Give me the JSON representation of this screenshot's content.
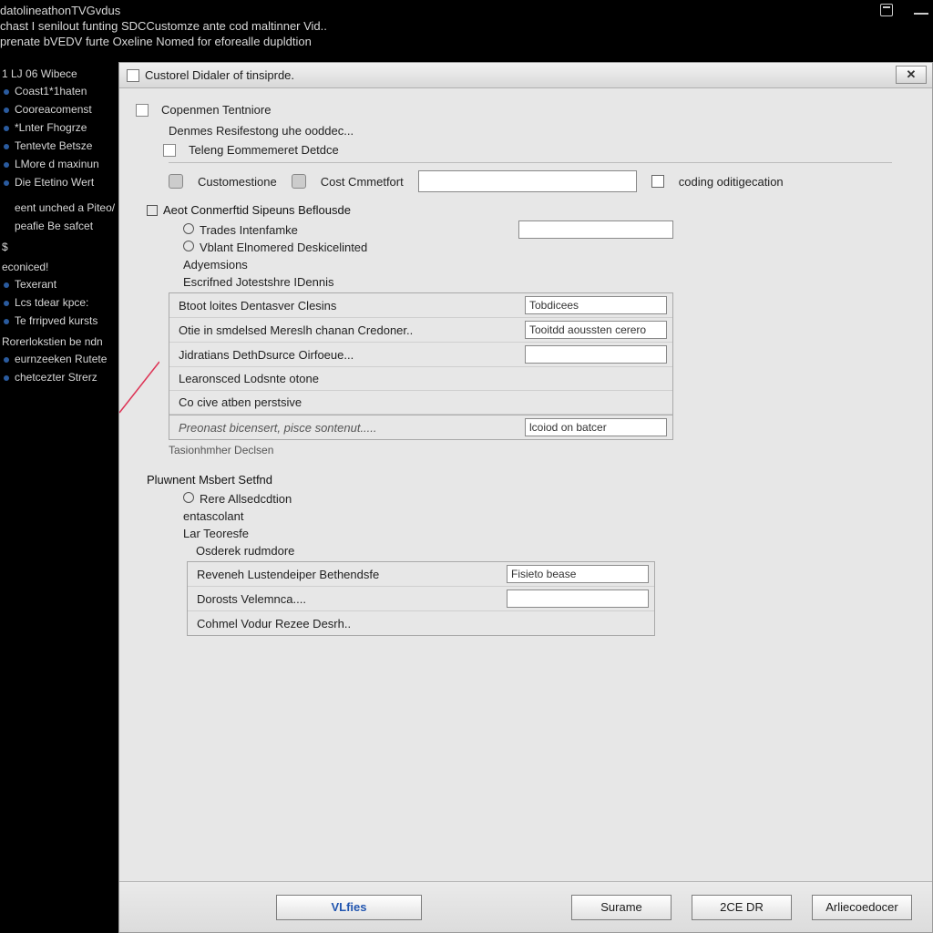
{
  "header": {
    "line1": "datolineathonTVGvdus",
    "line2": "chast I senilout funting SDCCustomze ante cod maltinner Vid..",
    "line3": "prenate bVEDV furte Oxeline Nomed for eforealle dupldtion"
  },
  "sidebar": {
    "groups": [
      {
        "head": "1 LJ 06 Wibece",
        "items": [
          "Coast1*1haten",
          "Cooreacomenst",
          "*Lnter Fhogrze",
          "Tentevte Betsze",
          "LMore d maxinun",
          "Die Etetino Wert"
        ]
      },
      {
        "head": " ",
        "items": [
          "eent unched a Piteo/",
          "peafie Be safcet"
        ]
      },
      {
        "head": "$",
        "items": []
      },
      {
        "head": "econiced!",
        "items": [
          "Texerant",
          "Lcs tdear kpce:",
          "Te frripved kursts"
        ]
      },
      {
        "head": "Rorerlokstien be ndn",
        "items": [
          "eurnzeeken Rutete",
          "chetcezter Strerz"
        ]
      }
    ]
  },
  "panel": {
    "title": "Custorel Didaler of tinsiprde."
  },
  "content": {
    "top": {
      "item1": "Copenmen Tentniore",
      "item2": "Denmes Resifestong uhe ooddec...",
      "item3": "Teleng Eommemeret Detdce"
    },
    "toolbar": {
      "btn1": "Customestione",
      "btn2": "Cost Cmmetfort",
      "chk_label": "coding oditigecation"
    },
    "section_a_head": "Aeot Conmerftid Sipeuns Beflousde",
    "section_a": {
      "r1": "Trades Intenfamke",
      "r2": "Vblant Elnomered Deskicelinted",
      "r3": "Adyemsions",
      "r4": "Escrifned Jotestshre IDennis"
    },
    "grid1": {
      "rows": [
        {
          "label": "Btoot loites Dentasver Clesins",
          "value": "Tobdicees"
        },
        {
          "label": "Otie in smdelsed Mereslh chanan Credoner..",
          "value": "Tooitdd aoussten cerero"
        },
        {
          "label": "Jidratians DethDsurce Oirfoeue...",
          "value": ""
        },
        {
          "label": "Learonsced Lodsnte otone",
          "value": null
        },
        {
          "label": "Co cive atben perstsive",
          "value": null
        },
        {
          "label": "Preonast bicensert, pisce sontenut.....",
          "value": "lcoiod on batcer",
          "footer": true
        }
      ]
    },
    "below_grid": "Tasionhmher Declsen",
    "section_b_head": "Pluwnent Msbert Setfnd",
    "section_b": {
      "r1": "Rere Allsedcdtion",
      "r2": "entascolant",
      "r3": "Lar Teoresfe",
      "r4": "Osderek rudmdore"
    },
    "grid2": {
      "rows": [
        {
          "label": "Reveneh Lustendeiper Bethendsfe",
          "value": "Fisieto bease"
        },
        {
          "label": "Dorosts Velemnca....",
          "value": ""
        },
        {
          "label": "Cohmel Vodur Rezee Desrh..",
          "value": null
        }
      ]
    }
  },
  "footer": {
    "b1": "VLfies",
    "b2": "Surame",
    "b3": "2CE DR",
    "b4": "Arliecoedocer"
  }
}
